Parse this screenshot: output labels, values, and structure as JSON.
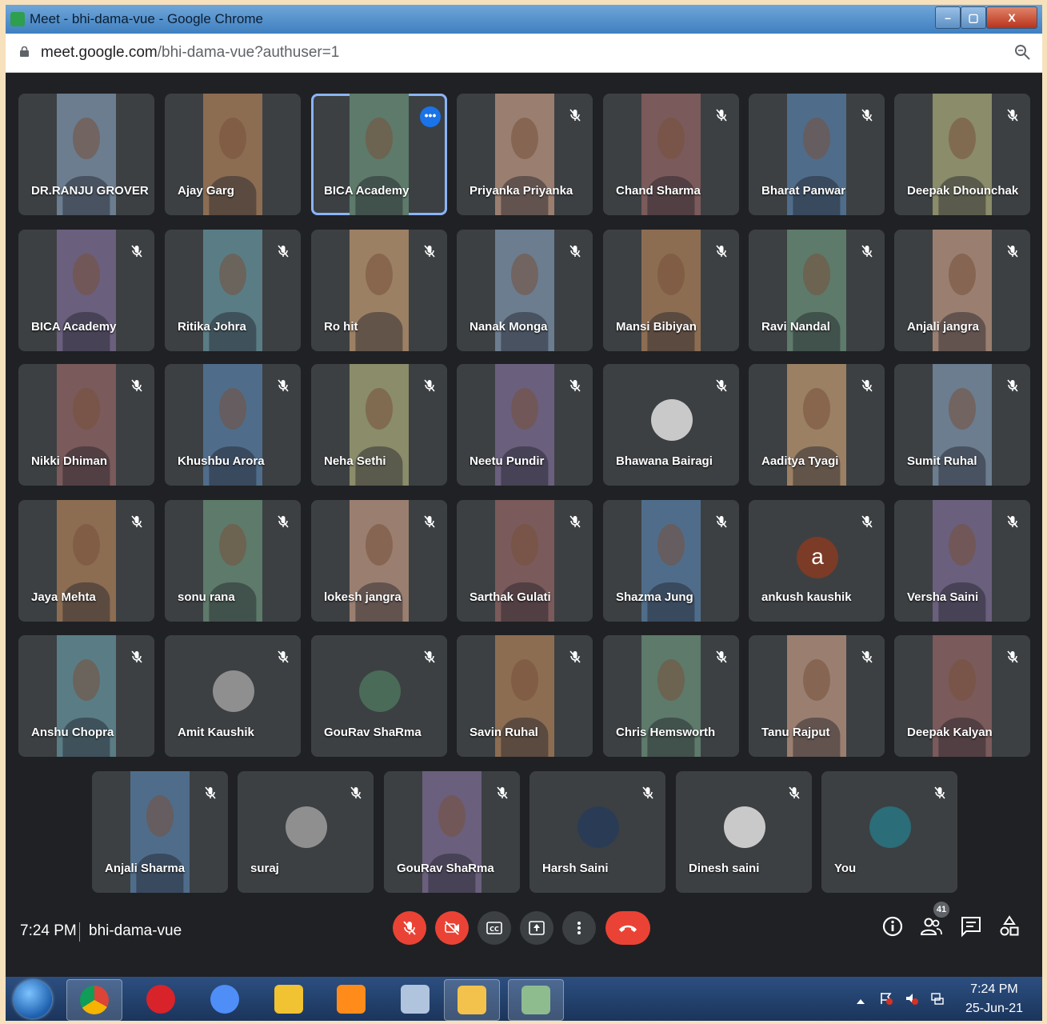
{
  "window": {
    "title": "Meet - bhi-dama-vue - Google Chrome",
    "min_label": "–",
    "max_label": "▢",
    "close_label": "X"
  },
  "address_bar": {
    "url_host": "meet.google.com",
    "url_path": "/bhi-dama-vue?authuser=1"
  },
  "meeting": {
    "participants": [
      {
        "name": "DR.RANJU GROVER",
        "type": "video",
        "muted": false
      },
      {
        "name": "Ajay Garg",
        "type": "video",
        "muted": false
      },
      {
        "name": "BICA Academy",
        "type": "video",
        "muted": false,
        "active": true
      },
      {
        "name": "Priyanka Priyanka",
        "type": "video",
        "muted": true
      },
      {
        "name": "Chand Sharma",
        "type": "video",
        "muted": true
      },
      {
        "name": "Bharat Panwar",
        "type": "video",
        "muted": true
      },
      {
        "name": "Deepak Dhounchak",
        "type": "video",
        "muted": true
      },
      {
        "name": "BICA Academy",
        "type": "video",
        "muted": true
      },
      {
        "name": "Ritika Johra",
        "type": "video",
        "muted": true
      },
      {
        "name": "Ro hit",
        "type": "video",
        "muted": true
      },
      {
        "name": "Nanak Monga",
        "type": "video",
        "muted": true
      },
      {
        "name": "Mansi Bibiyan",
        "type": "video",
        "muted": true
      },
      {
        "name": "Ravi Nandal",
        "type": "video",
        "muted": true
      },
      {
        "name": "Anjali jangra",
        "type": "video",
        "muted": true
      },
      {
        "name": "Nikki Dhiman",
        "type": "video",
        "muted": true
      },
      {
        "name": "Khushbu Arora",
        "type": "video",
        "muted": true
      },
      {
        "name": "Neha Sethi",
        "type": "video",
        "muted": true
      },
      {
        "name": "Neetu Pundir",
        "type": "video",
        "muted": true
      },
      {
        "name": "Bhawana Bairagi",
        "type": "avatar",
        "muted": true
      },
      {
        "name": "Aaditya Tyagi",
        "type": "video",
        "muted": true
      },
      {
        "name": "Sumit Ruhal",
        "type": "video",
        "muted": true
      },
      {
        "name": "Jaya Mehta",
        "type": "video",
        "muted": true
      },
      {
        "name": "sonu rana",
        "type": "video",
        "muted": true
      },
      {
        "name": "lokesh jangra",
        "type": "video",
        "muted": true
      },
      {
        "name": "Sarthak Gulati",
        "type": "video",
        "muted": true
      },
      {
        "name": "Shazma Jung",
        "type": "video",
        "muted": true
      },
      {
        "name": "ankush kaushik",
        "type": "letter",
        "letter": "a",
        "muted": true
      },
      {
        "name": "Versha Saini",
        "type": "video",
        "muted": true
      },
      {
        "name": "Anshu Chopra",
        "type": "video",
        "muted": true
      },
      {
        "name": "Amit Kaushik",
        "type": "avatar",
        "muted": true
      },
      {
        "name": "GouRav ShaRma",
        "type": "avatar",
        "muted": true
      },
      {
        "name": "Savin Ruhal",
        "type": "video",
        "muted": true
      },
      {
        "name": "Chris Hemsworth",
        "type": "video",
        "muted": true
      },
      {
        "name": "Tanu Rajput",
        "type": "video",
        "muted": true
      },
      {
        "name": "Deepak Kalyan",
        "type": "video",
        "muted": true
      },
      {
        "name": "Anjali Sharma",
        "type": "video",
        "muted": true
      },
      {
        "name": "suraj",
        "type": "avatar",
        "muted": true
      },
      {
        "name": "GouRav ShaRma",
        "type": "video",
        "muted": true
      },
      {
        "name": "Harsh Saini",
        "type": "avatar",
        "muted": true
      },
      {
        "name": "Dinesh saini",
        "type": "avatar",
        "muted": true
      },
      {
        "name": "You",
        "type": "avatar",
        "muted": true
      }
    ]
  },
  "bottom_bar": {
    "time": "7:24 PM",
    "meeting_code": "bhi-dama-vue",
    "people_count": "41",
    "controls": [
      "mic-off-icon",
      "camera-off-icon",
      "captions-icon",
      "present-icon",
      "more-options-icon",
      "leave-call-icon"
    ],
    "right_icons": [
      "info-icon",
      "people-icon",
      "chat-icon",
      "activities-icon"
    ]
  },
  "taskbar": {
    "clock_time": "7:24 PM",
    "clock_date": "25-Jun-21",
    "apps": [
      "chrome-icon",
      "opera-icon",
      "chromium-icon",
      "media-player-icon",
      "player-icon",
      "snipping-tool-icon",
      "file-explorer-icon",
      "paint-icon"
    ]
  },
  "colors": {
    "meet_bg": "#202124",
    "tile_bg": "#3c4043",
    "danger": "#ea4335",
    "active_border": "#8ab4f8"
  }
}
